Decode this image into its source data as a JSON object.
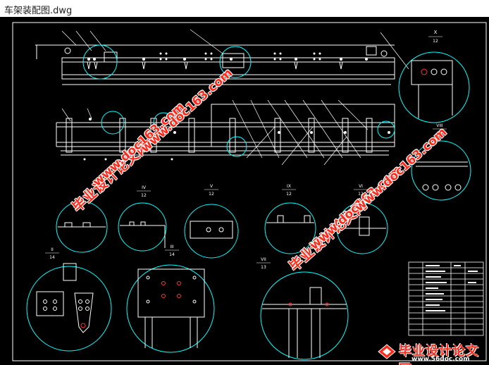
{
  "window": {
    "title": "车架装配图.dwg"
  },
  "drawing": {
    "background": "#000000",
    "line_color": "#ffffff",
    "circle_color": "#00ffff",
    "accent_red": "#ff3333",
    "views": [
      {
        "id": "X",
        "scale": "12"
      },
      {
        "id": "VIII",
        "scale": "12"
      },
      {
        "id": "IV",
        "scale": "12"
      },
      {
        "id": "V",
        "scale": "12"
      },
      {
        "id": "IX",
        "scale": "12"
      },
      {
        "id": "VI",
        "scale": "12"
      },
      {
        "id": "II",
        "scale": "14"
      },
      {
        "id": "III",
        "scale": "14"
      },
      {
        "id": "VII",
        "scale": "13"
      }
    ]
  },
  "watermarks": {
    "cn": "毕业设计论文网",
    "en": "www.doc163.com"
  },
  "logo": {
    "cn": "毕业设计论文网",
    "en": "www.56doc.com"
  }
}
